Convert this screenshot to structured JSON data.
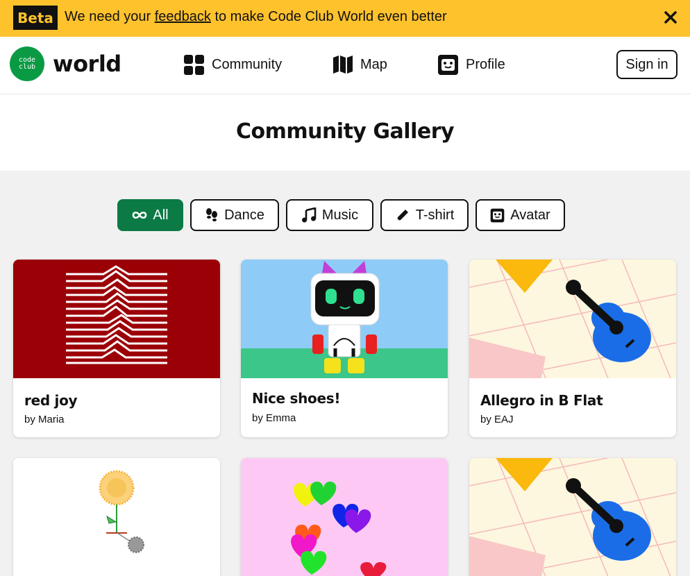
{
  "banner": {
    "badge": "Beta",
    "text_before": "We need your ",
    "link": "feedback",
    "text_after": " to make Code Club World even better"
  },
  "header": {
    "logo_line1": "code",
    "logo_line2": "club",
    "logo_word": "world",
    "nav": [
      {
        "label": "Community",
        "icon": "grid-icon"
      },
      {
        "label": "Map",
        "icon": "map-icon"
      },
      {
        "label": "Profile",
        "icon": "face-icon"
      }
    ],
    "signin": "Sign in"
  },
  "page": {
    "title": "Community Gallery"
  },
  "filters": [
    {
      "label": "All",
      "icon": "infinity-icon",
      "active": true
    },
    {
      "label": "Dance",
      "icon": "footprints-icon",
      "active": false
    },
    {
      "label": "Music",
      "icon": "music-note-icon",
      "active": false
    },
    {
      "label": "T-shirt",
      "icon": "pencil-icon",
      "active": false
    },
    {
      "label": "Avatar",
      "icon": "face-icon",
      "active": false
    }
  ],
  "cards": [
    {
      "title": "red joy",
      "author": "by Maria"
    },
    {
      "title": "Nice shoes!",
      "author": "by Emma"
    },
    {
      "title": "Allegro in B Flat",
      "author": "by EAJ"
    },
    {
      "title": "",
      "author": ""
    },
    {
      "title": "",
      "author": ""
    },
    {
      "title": "",
      "author": ""
    }
  ],
  "colors": {
    "banner": "#fec22d",
    "brand_green": "#0b9a44",
    "active_filter": "#0b7a45",
    "red_joy_bg": "#9b0007",
    "sky": "#8ecbf7",
    "grass": "#3cc68a",
    "guitar_blue": "#1a6de6",
    "paper": "#fdf7df",
    "hearts_bg": "#fdc9f4"
  }
}
